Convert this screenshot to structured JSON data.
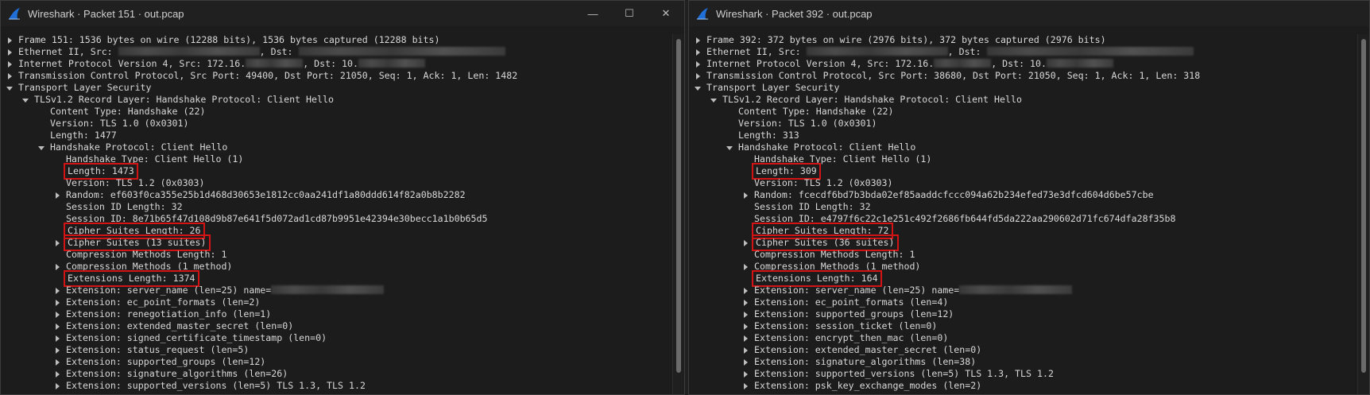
{
  "windows": [
    {
      "title": "Wireshark · Packet 151 · out.pcap",
      "show_controls": true,
      "controls": {
        "minimize": "—",
        "maximize": "☐",
        "close": "✕"
      },
      "rows": [
        {
          "indent": 0,
          "toggle": "collapsed",
          "text": "Frame 151: 1536 bytes on wire (12288 bits), 1536 bytes captured (12288 bits)"
        },
        {
          "indent": 0,
          "toggle": "collapsed",
          "text": "Ethernet II, Src: ",
          "redact_w": 178,
          "text2": ", Dst: ",
          "redact2_w": 260
        },
        {
          "indent": 0,
          "toggle": "collapsed",
          "text": "Internet Protocol Version 4, Src: 172.16.",
          "redact_w": 72,
          "text2": ", Dst: 10.",
          "redact2_w": 84
        },
        {
          "indent": 0,
          "toggle": "collapsed",
          "text": "Transmission Control Protocol, Src Port: 49400, Dst Port: 21050, Seq: 1, Ack: 1, Len: 1482"
        },
        {
          "indent": 0,
          "toggle": "expanded",
          "text": "Transport Layer Security"
        },
        {
          "indent": 1,
          "toggle": "expanded",
          "text": "TLSv1.2 Record Layer: Handshake Protocol: Client Hello"
        },
        {
          "indent": 2,
          "toggle": "none",
          "text": "Content Type: Handshake (22)"
        },
        {
          "indent": 2,
          "toggle": "none",
          "text": "Version: TLS 1.0 (0x0301)"
        },
        {
          "indent": 2,
          "toggle": "none",
          "text": "Length: 1477"
        },
        {
          "indent": 2,
          "toggle": "expanded",
          "text": "Handshake Protocol: Client Hello"
        },
        {
          "indent": 3,
          "toggle": "none",
          "text": "Handshake Type: Client Hello (1)"
        },
        {
          "indent": 3,
          "toggle": "none",
          "text": "Length: 1473",
          "highlight": true
        },
        {
          "indent": 3,
          "toggle": "none",
          "text": "Version: TLS 1.2 (0x0303)"
        },
        {
          "indent": 3,
          "toggle": "collapsed",
          "text": "Random: ef603f0ca355e25b1d468d30653e1812cc0aa241df1a80ddd614f82a0b8b2282"
        },
        {
          "indent": 3,
          "toggle": "none",
          "text": "Session ID Length: 32"
        },
        {
          "indent": 3,
          "toggle": "none",
          "text": "Session ID: 8e71b65f47d108d9b87e641f5d072ad1cd87b9951e42394e30becc1a1b0b65d5"
        },
        {
          "indent": 3,
          "toggle": "none",
          "text": "Cipher Suites Length: 26",
          "highlight": true
        },
        {
          "indent": 3,
          "toggle": "collapsed",
          "text": "Cipher Suites (13 suites)",
          "highlight": true
        },
        {
          "indent": 3,
          "toggle": "none",
          "text": "Compression Methods Length: 1"
        },
        {
          "indent": 3,
          "toggle": "collapsed",
          "text": "Compression Methods (1 method)"
        },
        {
          "indent": 3,
          "toggle": "none",
          "text": "Extensions Length: 1374",
          "highlight": true
        },
        {
          "indent": 3,
          "toggle": "collapsed",
          "text": "Extension: server_name (len=25) name=",
          "redact_w": 142
        },
        {
          "indent": 3,
          "toggle": "collapsed",
          "text": "Extension: ec_point_formats (len=2)"
        },
        {
          "indent": 3,
          "toggle": "collapsed",
          "text": "Extension: renegotiation_info (len=1)"
        },
        {
          "indent": 3,
          "toggle": "collapsed",
          "text": "Extension: extended_master_secret (len=0)"
        },
        {
          "indent": 3,
          "toggle": "collapsed",
          "text": "Extension: signed_certificate_timestamp (len=0)"
        },
        {
          "indent": 3,
          "toggle": "collapsed",
          "text": "Extension: status_request (len=5)"
        },
        {
          "indent": 3,
          "toggle": "collapsed",
          "text": "Extension: supported_groups (len=12)"
        },
        {
          "indent": 3,
          "toggle": "collapsed",
          "text": "Extension: signature_algorithms (len=26)"
        },
        {
          "indent": 3,
          "toggle": "collapsed",
          "text": "Extension: supported_versions (len=5) TLS 1.3, TLS 1.2"
        }
      ]
    },
    {
      "title": "Wireshark · Packet 392 · out.pcap",
      "show_controls": false,
      "controls": {
        "minimize": "",
        "maximize": "",
        "close": ""
      },
      "rows": [
        {
          "indent": 0,
          "toggle": "collapsed",
          "text": "Frame 392: 372 bytes on wire (2976 bits), 372 bytes captured (2976 bits)"
        },
        {
          "indent": 0,
          "toggle": "collapsed",
          "text": "Ethernet II, Src: ",
          "redact_w": 178,
          "text2": ", Dst: ",
          "redact2_w": 260
        },
        {
          "indent": 0,
          "toggle": "collapsed",
          "text": "Internet Protocol Version 4, Src: 172.16.",
          "redact_w": 72,
          "text2": ", Dst: 10.",
          "redact2_w": 84
        },
        {
          "indent": 0,
          "toggle": "collapsed",
          "text": "Transmission Control Protocol, Src Port: 38680, Dst Port: 21050, Seq: 1, Ack: 1, Len: 318"
        },
        {
          "indent": 0,
          "toggle": "expanded",
          "text": "Transport Layer Security"
        },
        {
          "indent": 1,
          "toggle": "expanded",
          "text": "TLSv1.2 Record Layer: Handshake Protocol: Client Hello"
        },
        {
          "indent": 2,
          "toggle": "none",
          "text": "Content Type: Handshake (22)"
        },
        {
          "indent": 2,
          "toggle": "none",
          "text": "Version: TLS 1.0 (0x0301)"
        },
        {
          "indent": 2,
          "toggle": "none",
          "text": "Length: 313"
        },
        {
          "indent": 2,
          "toggle": "expanded",
          "text": "Handshake Protocol: Client Hello"
        },
        {
          "indent": 3,
          "toggle": "none",
          "text": "Handshake Type: Client Hello (1)"
        },
        {
          "indent": 3,
          "toggle": "none",
          "text": "Length: 309",
          "highlight": true
        },
        {
          "indent": 3,
          "toggle": "none",
          "text": "Version: TLS 1.2 (0x0303)"
        },
        {
          "indent": 3,
          "toggle": "collapsed",
          "text": "Random: fcecdf6bd7b3bda02ef85aaddcfccc094a62b234efed73e3dfcd604d6be57cbe"
        },
        {
          "indent": 3,
          "toggle": "none",
          "text": "Session ID Length: 32"
        },
        {
          "indent": 3,
          "toggle": "none",
          "text": "Session ID: e4797f6c22c1e251c492f2686fb644fd5da222aa290602d71fc674dfa28f35b8"
        },
        {
          "indent": 3,
          "toggle": "none",
          "text": "Cipher Suites Length: 72",
          "highlight": true
        },
        {
          "indent": 3,
          "toggle": "collapsed",
          "text": "Cipher Suites (36 suites)",
          "highlight": true
        },
        {
          "indent": 3,
          "toggle": "none",
          "text": "Compression Methods Length: 1"
        },
        {
          "indent": 3,
          "toggle": "collapsed",
          "text": "Compression Methods (1 method)"
        },
        {
          "indent": 3,
          "toggle": "none",
          "text": "Extensions Length: 164",
          "highlight": true
        },
        {
          "indent": 3,
          "toggle": "collapsed",
          "text": "Extension: server_name (len=25) name=",
          "redact_w": 142
        },
        {
          "indent": 3,
          "toggle": "collapsed",
          "text": "Extension: ec_point_formats (len=4)"
        },
        {
          "indent": 3,
          "toggle": "collapsed",
          "text": "Extension: supported_groups (len=12)"
        },
        {
          "indent": 3,
          "toggle": "collapsed",
          "text": "Extension: session_ticket (len=0)"
        },
        {
          "indent": 3,
          "toggle": "collapsed",
          "text": "Extension: encrypt_then_mac (len=0)"
        },
        {
          "indent": 3,
          "toggle": "collapsed",
          "text": "Extension: extended_master_secret (len=0)"
        },
        {
          "indent": 3,
          "toggle": "collapsed",
          "text": "Extension: signature_algorithms (len=38)"
        },
        {
          "indent": 3,
          "toggle": "collapsed",
          "text": "Extension: supported_versions (len=5) TLS 1.3, TLS 1.2"
        },
        {
          "indent": 3,
          "toggle": "collapsed",
          "text": "Extension: psk_key_exchange_modes (len=2)"
        }
      ]
    }
  ],
  "colors": {
    "window_bg": "#1c1c1c",
    "titlebar_bg": "#202020",
    "text": "#d8d8d8",
    "highlight_box": "#d21414",
    "shark_fin": "#1f6fd6"
  }
}
